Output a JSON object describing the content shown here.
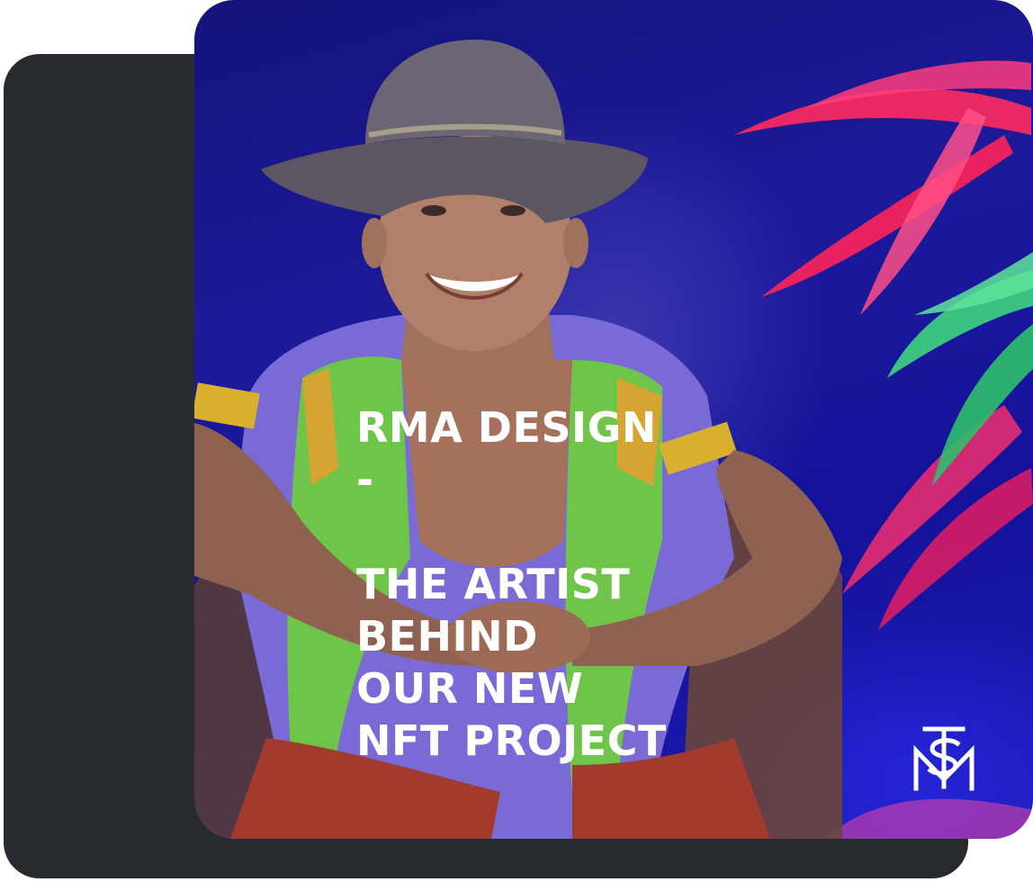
{
  "post": {
    "headline_lines": [
      "RMA DESIGN",
      "-",
      "",
      "THE ARTIST",
      "BEHIND",
      "OUR NEW",
      "NFT PROJECT"
    ],
    "logo_icon": "tsm-monogram-icon"
  },
  "colors": {
    "back_card": "#272a2f",
    "background_blue": "#1c1a9a",
    "headline_text": "#ffffff",
    "palm_pink": "#ff2f6c",
    "palm_green": "#3fd47e"
  }
}
